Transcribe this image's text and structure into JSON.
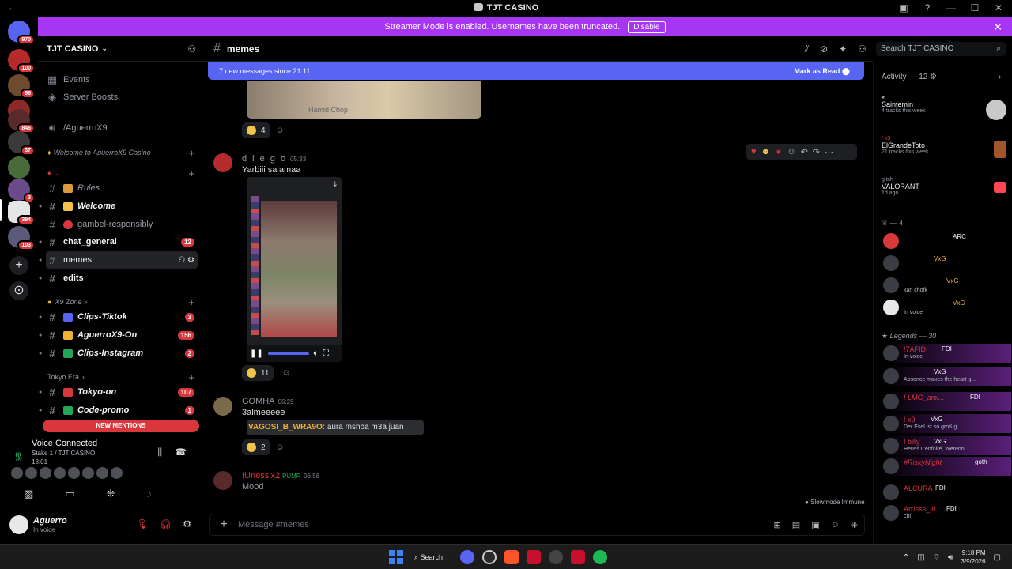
{
  "window": {
    "title": "TJT CASINO",
    "back_label": "←",
    "forward_label": "→",
    "controls": [
      "—",
      "☐",
      "✕"
    ]
  },
  "banner": {
    "text": "Streamer Mode is enabled. Usernames have been truncated.",
    "button": "Disable",
    "close": "✕"
  },
  "rail": {
    "badges": [
      "970",
      "100",
      "96",
      "846",
      "37",
      "3",
      "394",
      "103"
    ]
  },
  "guild": {
    "name": "TJT CASINO",
    "items": [
      {
        "label": "Events"
      },
      {
        "label": "Server Boosts"
      },
      {
        "label": "/AguerroX9"
      }
    ],
    "categories": {
      "welcome": "Welcome to AguerroX9 Casino",
      "x9zone": "X9 Zone",
      "tokyo": "Tokyo Era"
    },
    "channels": [
      {
        "label": "Rules",
        "style": "italic"
      },
      {
        "label": "Welcome",
        "style": "bold-italic"
      },
      {
        "label": "gambel-responsibly",
        "style": "normal"
      },
      {
        "label": "chat_general",
        "count": "12"
      },
      {
        "label": "memes"
      },
      {
        "label": "edits"
      },
      {
        "label": "Clips-Tiktok",
        "count": "3"
      },
      {
        "label": "AguerroX9-On",
        "count": "156"
      },
      {
        "label": "Clips-Instagram",
        "count": "2"
      },
      {
        "label": "Tokyo-on",
        "count": "107"
      },
      {
        "label": "Code-promo",
        "count": "1"
      }
    ],
    "new_mentions": "NEW MENTIONS"
  },
  "voice": {
    "title": "Voice Connected",
    "sub": "Stake 1 / TJT CASINO",
    "time": "18:01"
  },
  "user": {
    "name": "Aguerro",
    "status": "In voice"
  },
  "chat": {
    "channel": "memes",
    "new_messages": "7 new messages since 21:11",
    "mark_read": "Mark as Read",
    "image_watermark": "Hamid Chop",
    "reaction1_count": "4",
    "messages": [
      {
        "author": "d i e g o",
        "time": "05:33",
        "text": "Yarbiii salamaa",
        "reaction_count": "11"
      },
      {
        "author": "GOMHA",
        "time": "06:29",
        "text": "3almeeeee",
        "quote_author": "VAGOSI_B_WRA9O:",
        "quote_text": "aura mshba m3a juan",
        "reaction_count": "2"
      },
      {
        "author": "!Uness'x2",
        "role": "PUMP",
        "time": "06:58",
        "text": "Mood"
      }
    ],
    "slowmode": "Slowmode Immune",
    "composer_placeholder": "Message #memes"
  },
  "search": {
    "placeholder": "Search TJT CASINO"
  },
  "members": {
    "activity_title": "Activity — 12",
    "activities": [
      {
        "name": "Saintemin",
        "sub": "4 tracks this week"
      },
      {
        "name": "ElGrandeToto",
        "sub": "21 tracks this week",
        "pre": "! x9"
      },
      {
        "name": "VALORANT",
        "sub": "1d ago",
        "pre": "gltxh"
      }
    ],
    "group1": "— 4",
    "group1_members": [
      {
        "tags": "ARC"
      },
      {
        "tags": "VxG"
      },
      {
        "tags": "VxG",
        "status": "kan chofk"
      },
      {
        "tags": "VxG",
        "status": "In voice"
      }
    ],
    "group2": "Legends — 30",
    "group2_members": [
      {
        "name": "!7AFID!",
        "tags": "FDI",
        "status": "In voice"
      },
      {
        "name": "",
        "tags": "VxG",
        "status": "Absence makes the heart g..."
      },
      {
        "name": "! LMG_ami...",
        "tags": "FDI"
      },
      {
        "name": "! x9",
        "tags": "VxG",
        "status": "Der Esel ist so groß g..."
      },
      {
        "name": "! billy",
        "tags": "VxG",
        "status": "Heuss L'enfoiré, Werenoi"
      },
      {
        "name": "#RiskyNight",
        "tags": "goth"
      },
      {
        "name": "ALCURA",
        "tags": "FDI"
      },
      {
        "name": "An'lsss_ill",
        "tags": "FDI",
        "status": "chi"
      }
    ]
  },
  "taskbar": {
    "search": "Search",
    "time": "9:18 PM",
    "date": "3/9/2026"
  }
}
